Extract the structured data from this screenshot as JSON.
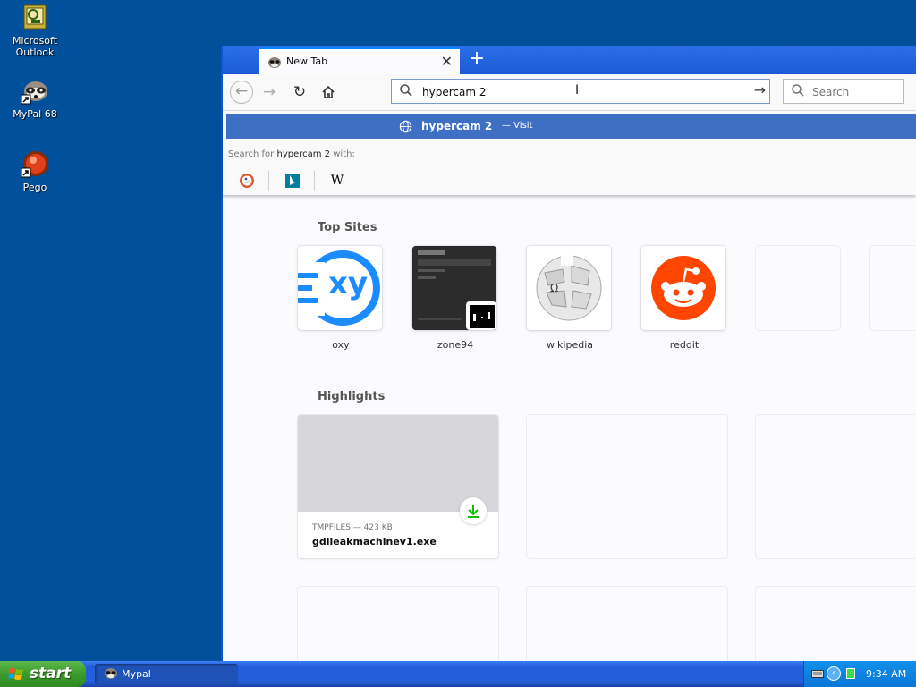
{
  "desktop": {
    "icons": [
      {
        "label": "Microsoft Outlook",
        "icon": "outlook-icon"
      },
      {
        "label": "MyPal 68",
        "icon": "mypal-icon"
      },
      {
        "label": "Pego",
        "icon": "pego-icon"
      }
    ]
  },
  "browser": {
    "tab": {
      "title": "New Tab"
    },
    "urlbar": {
      "value": "hypercam 2"
    },
    "searchbar": {
      "placeholder": "Search"
    },
    "dropdown": {
      "visit_title": "hypercam 2",
      "visit_suffix": "— Visit",
      "search_prefix": "Search for",
      "search_term": "hypercam 2",
      "search_suffix": "with:",
      "engines": [
        "duckduckgo-icon",
        "bing-icon",
        "wikipedia-icon"
      ],
      "wikipedia_letter": "W"
    },
    "newtab": {
      "top_sites_title": "Top Sites",
      "top_sites": [
        {
          "name": "oxy",
          "tile_text": "xy"
        },
        {
          "name": "zone94"
        },
        {
          "name": "wikipedia",
          "tile_text": "Ω"
        },
        {
          "name": "reddit"
        }
      ],
      "highlights_title": "Highlights",
      "highlight": {
        "meta": "TMPFILES — 423 KB",
        "filename": "gdileakmachinev1.exe"
      }
    }
  },
  "taskbar": {
    "start_label": "start",
    "task_label": "Mypal",
    "clock": "9:34 AM"
  },
  "colors": {
    "desktop": "#00509c",
    "visit_row": "#3d6fc4",
    "reddit": "#ff4500",
    "oxy": "#1a8cff",
    "start": "#3c9a2c"
  }
}
